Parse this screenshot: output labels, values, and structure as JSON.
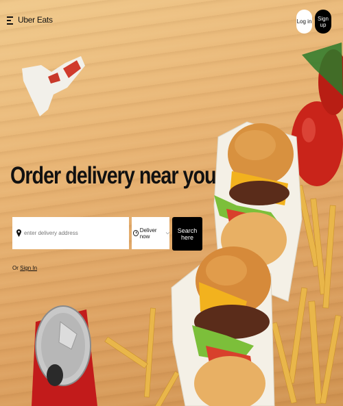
{
  "header": {
    "logo_text": "Uber Eats",
    "login_label": "Log in",
    "signup_label": "Sign up"
  },
  "hero": {
    "title": "Order delivery near you",
    "address_placeholder": "enter delivery address",
    "deliver_option": "Deliver now",
    "search_label": "Search here",
    "signin_prefix": "Or",
    "signin_link": "Sign In"
  },
  "colors": {
    "background": "#e8b474",
    "primary": "#000000",
    "button_text": "#ffffff"
  },
  "icons": [
    "menu-icon",
    "location-pin-icon",
    "clock-icon",
    "chevron-down-icon"
  ]
}
